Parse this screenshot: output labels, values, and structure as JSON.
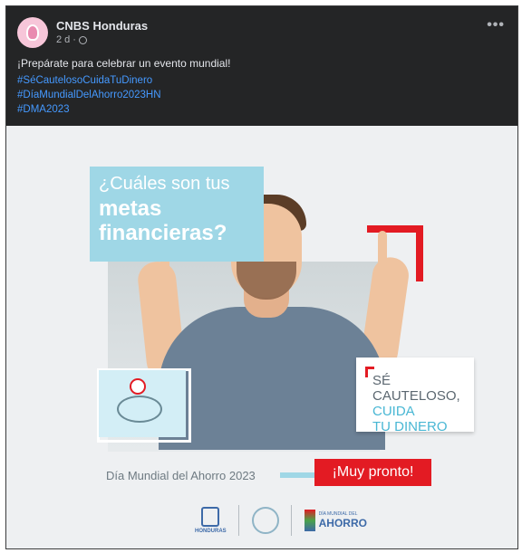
{
  "post": {
    "page_name": "CNBS Honduras",
    "time": "2 d",
    "text": "¡Prepárate para celebrar un evento mundial!",
    "hashtags": [
      "#SéCautelosoCuidaTuDinero",
      "#DíaMundialDelAhorro2023HN",
      "#DMA2023"
    ],
    "menu_label": "•••"
  },
  "image": {
    "question_line1": "¿Cuáles son tus",
    "question_line2": "metas",
    "question_line3": "financieras?",
    "card_line1": "SÉ",
    "card_line2": "CAUTELOSO,",
    "card_line3": "CUIDA",
    "card_line4": "TU DINERO",
    "event_line": "Día Mundial del Ahorro 2023",
    "cta": "¡Muy pronto!",
    "logo1_text": "HONDURAS",
    "logo3_small": "DÍA MUNDIAL DEL",
    "logo3_big": "AHORRO"
  },
  "colors": {
    "post_background": "#242526",
    "hashtag": "#4599ff",
    "accent_red": "#e31b23",
    "accent_light_blue": "#9fd7e6"
  }
}
